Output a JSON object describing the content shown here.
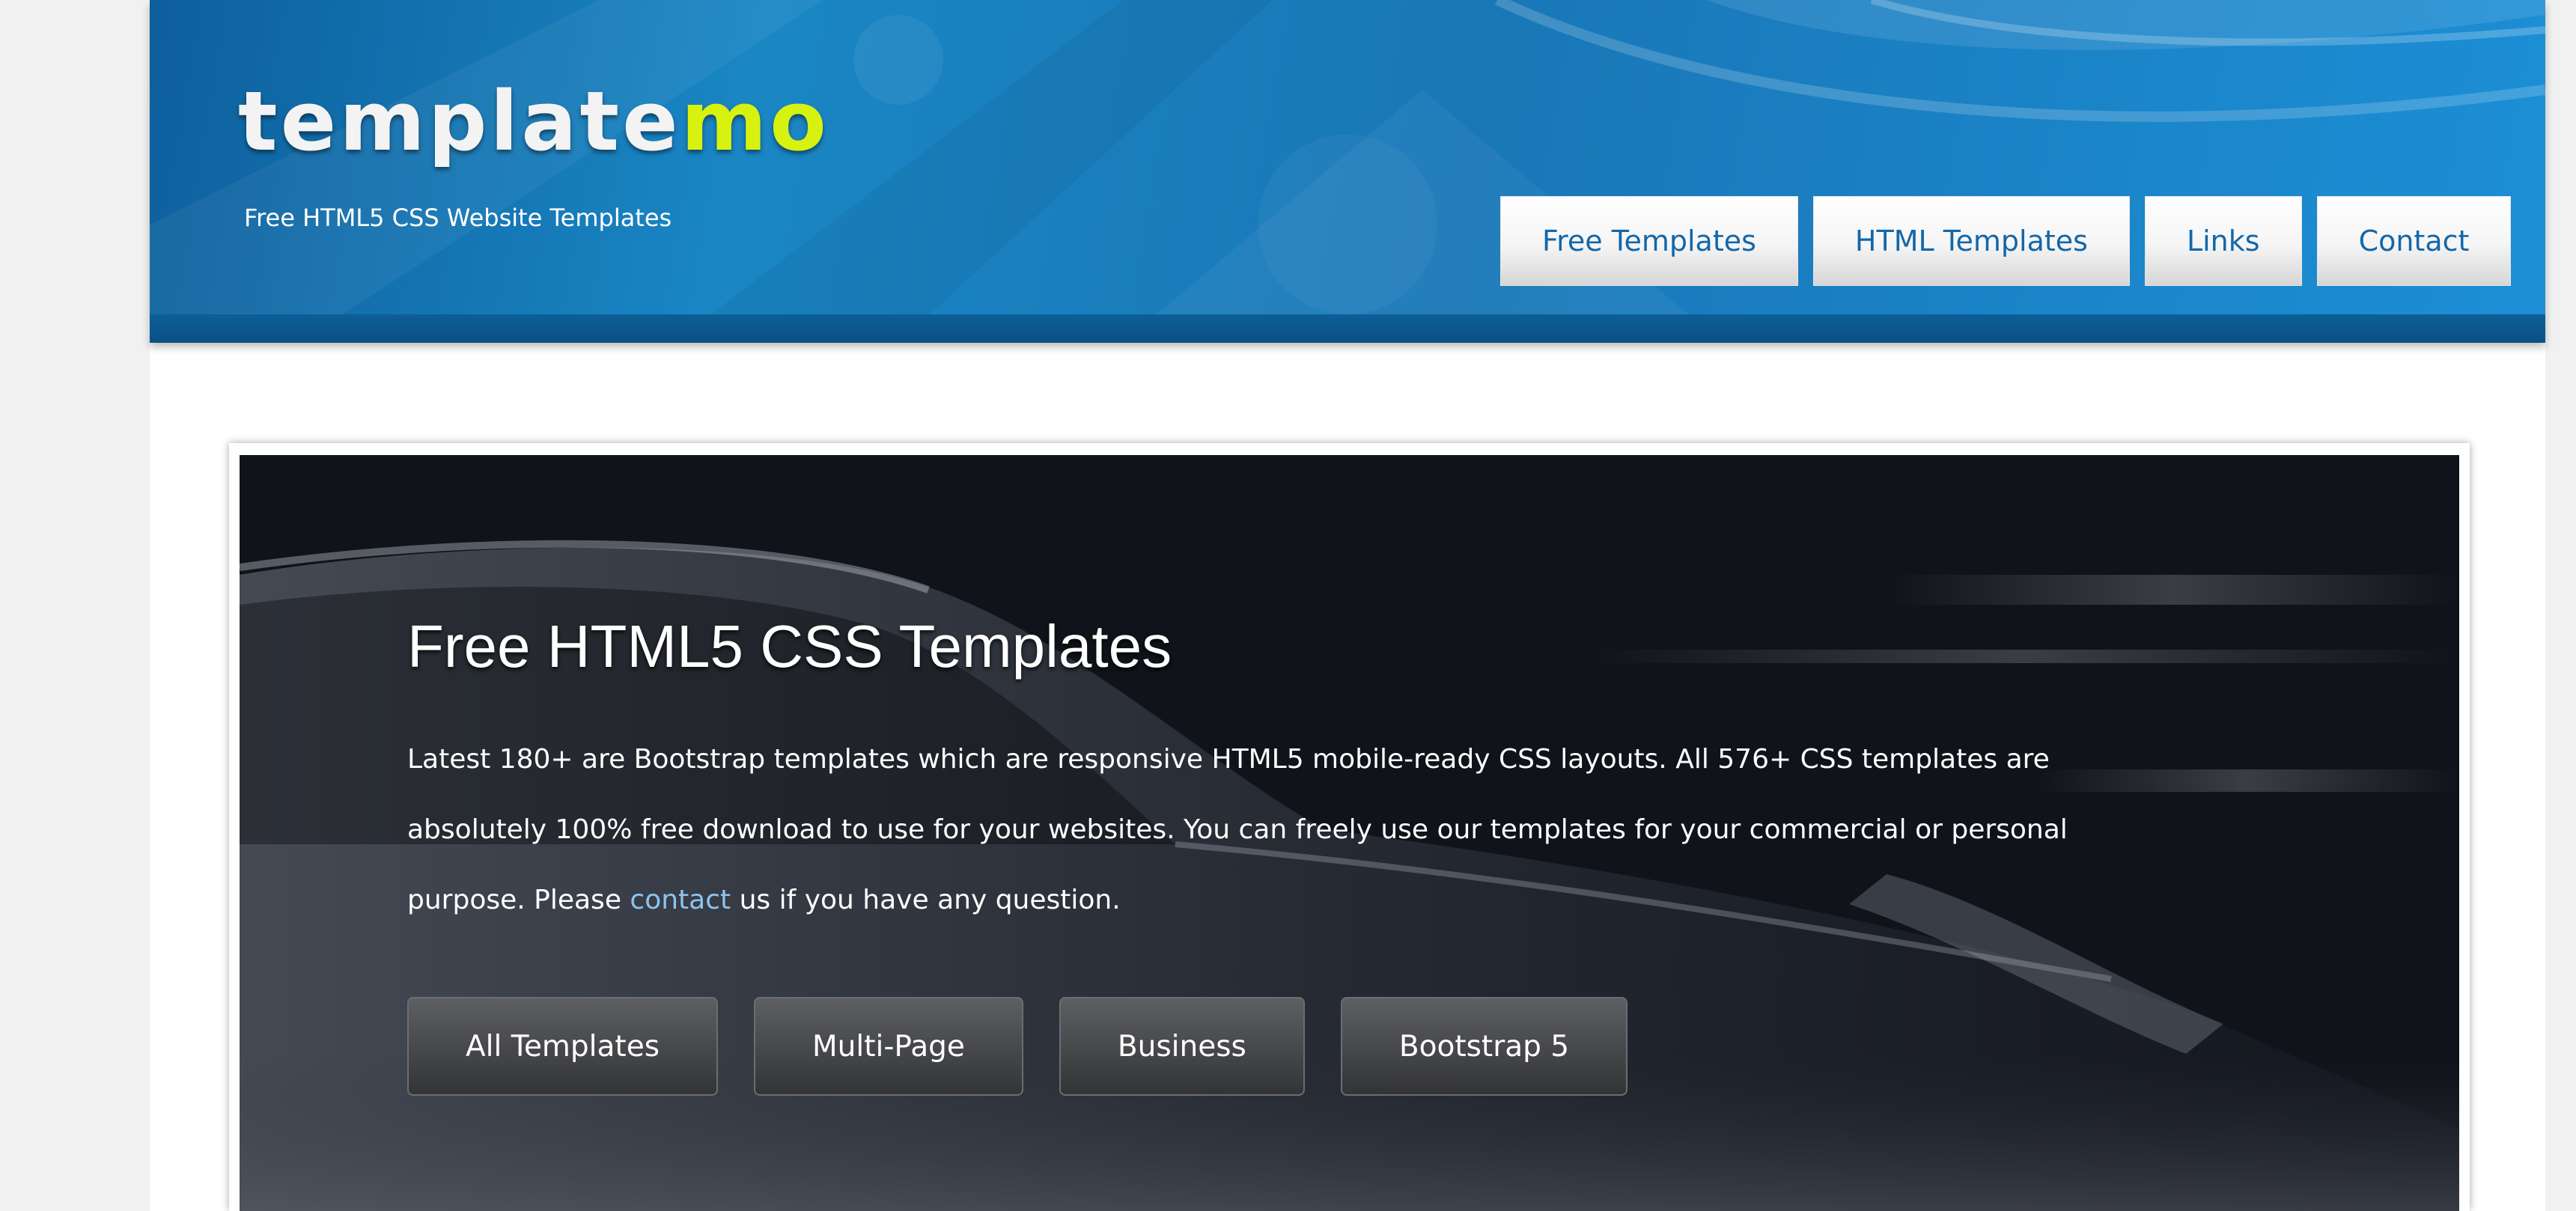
{
  "header": {
    "logo_main": "template",
    "logo_accent": "mo",
    "tagline": "Free HTML5 CSS Website Templates",
    "nav": [
      {
        "label": "Free Templates"
      },
      {
        "label": "HTML Templates"
      },
      {
        "label": "Links"
      },
      {
        "label": "Contact"
      }
    ]
  },
  "hero": {
    "title": "Free HTML5 CSS Templates",
    "text_part1": "Latest 180+ are Bootstrap templates which are responsive HTML5 mobile-ready CSS layouts. All 576+ CSS templates are absolutely 100% free download to use for your websites. You can freely use our templates for your commercial or personal purpose. Please ",
    "contact_link": "contact",
    "text_part2": " us if you have any question.",
    "buttons": [
      {
        "label": "All Templates"
      },
      {
        "label": "Multi-Page"
      },
      {
        "label": "Business"
      },
      {
        "label": "Bootstrap 5"
      }
    ]
  },
  "colors": {
    "header_blue": "#1a86c4",
    "logo_accent": "#d8f20f",
    "nav_text": "#1467a9",
    "link": "#8ec3f0",
    "hero_bg": "#12151d"
  }
}
